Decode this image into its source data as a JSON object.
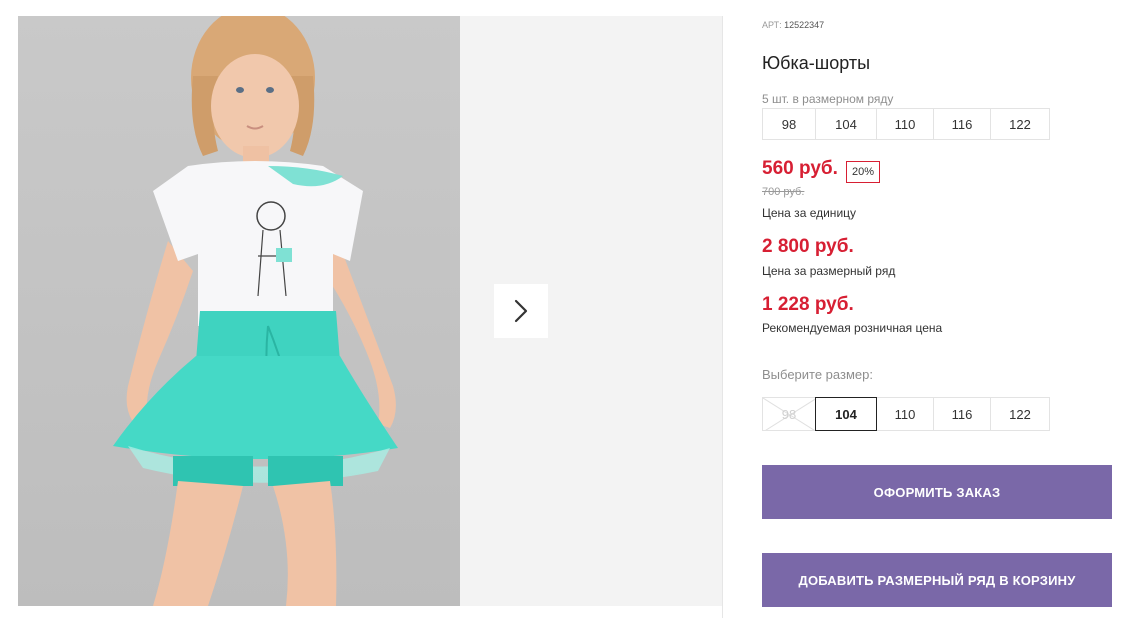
{
  "product": {
    "sku_label": "АРТ:",
    "sku": "12522347",
    "title": "Юбка-шорты"
  },
  "pack": {
    "note": "5 шт. в размерном ряду",
    "sizes": [
      "98",
      "104",
      "110",
      "116",
      "122"
    ]
  },
  "pricing": {
    "unit_price": "560 руб.",
    "discount": "20%",
    "old_price": "700 руб.",
    "unit_caption": "Цена за единицу",
    "pack_price": "2 800 руб.",
    "pack_caption": "Цена за размерный ряд",
    "retail_price": "1 228 руб.",
    "retail_caption": "Рекомендуемая розничная цена"
  },
  "size_picker": {
    "label": "Выберите размер:",
    "options": [
      {
        "label": "98",
        "state": "disabled"
      },
      {
        "label": "104",
        "state": "selected"
      },
      {
        "label": "110",
        "state": "available"
      },
      {
        "label": "116",
        "state": "available"
      },
      {
        "label": "122",
        "state": "available"
      }
    ]
  },
  "actions": {
    "order_label": "ОФОРМИТЬ ЗАКАЗ",
    "add_to_cart_label": "ДОБАВИТЬ РАЗМЕРНЫЙ РЯД В КОРЗИНУ"
  },
  "gallery": {
    "next_icon": "chevron-right-icon"
  },
  "colors": {
    "price_red": "#d71f33",
    "button_purple": "#7a68a8",
    "skirt_mint": "#45d9c6"
  }
}
